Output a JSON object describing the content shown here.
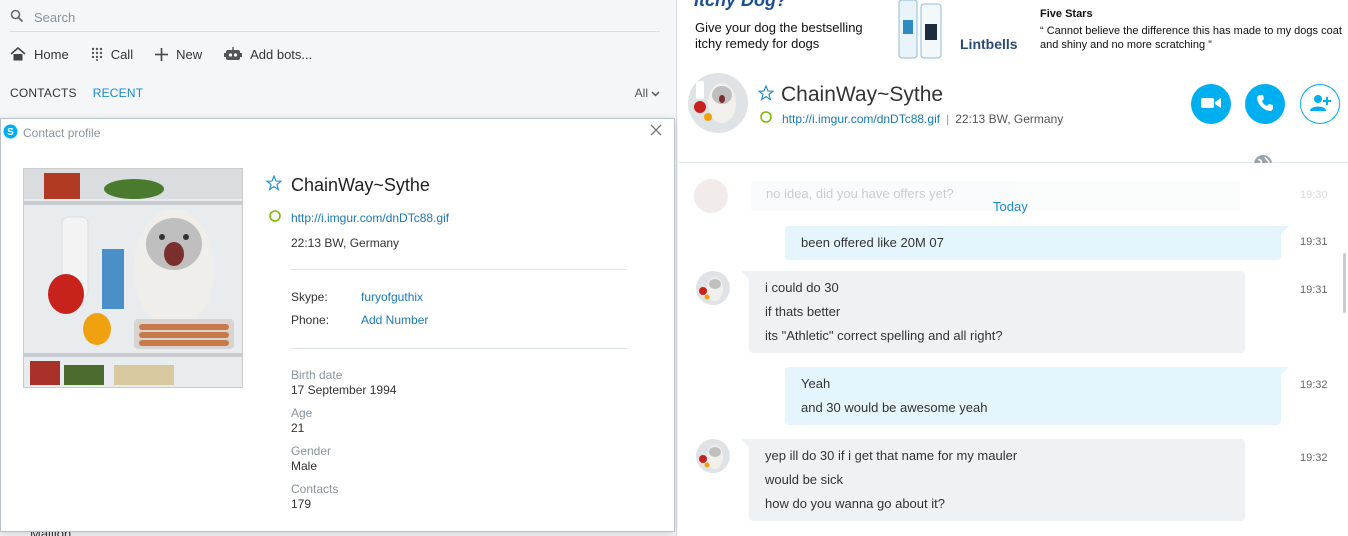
{
  "search": {
    "placeholder": "Search"
  },
  "toolbar": {
    "home": "Home",
    "call": "Call",
    "new": "New",
    "add_bots": "Add bots..."
  },
  "contacts_tabs": {
    "contacts": "CONTACTS",
    "recent": "RECENT",
    "filter": "All"
  },
  "left_list_partial": "Maillon",
  "profile": {
    "title": "Contact profile",
    "name": "ChainWay~Sythe",
    "mood_link": "http://i.imgur.com/dnDTc88.gif",
    "location": "22:13 BW, Germany",
    "skype_label": "Skype:",
    "skype_value": "furyofguthix",
    "phone_label": "Phone:",
    "phone_value": "Add Number",
    "birth_label": "Birth date",
    "birth_value": "17 September 1994",
    "age_label": "Age",
    "age_value": "21",
    "gender_label": "Gender",
    "gender_value": "Male",
    "contacts_label": "Contacts",
    "contacts_value": "179"
  },
  "ad": {
    "headline": "Itchy Dog?",
    "text": "Give your dog the bestselling itchy remedy for dogs",
    "brand": "Lintbells",
    "stars": "Five Stars",
    "quote": "Cannot believe the difference this has made to my dogs coat and shiny and no more scratching"
  },
  "chat_header": {
    "name": "ChainWay~Sythe",
    "link": "http://i.imgur.com/dnDTc88.gif",
    "separator": "|",
    "location": "22:13 BW, Germany"
  },
  "messages": {
    "faded": "no idea, did you have offers yet?",
    "faded_time": "19:30",
    "day_label": "Today",
    "list": [
      {
        "dir": "out",
        "lines": [
          "been offered like 20M 07"
        ],
        "time": "19:31"
      },
      {
        "dir": "in",
        "lines": [
          "i could do 30",
          "if thats better",
          "its \"Athletic\" correct spelling and all right?"
        ],
        "time": "19:31"
      },
      {
        "dir": "out",
        "lines": [
          "Yeah",
          "and 30 would be awesome yeah"
        ],
        "time": "19:32"
      },
      {
        "dir": "in",
        "lines": [
          "yep ill do 30 if i get that name for my mauler",
          "would be sick",
          "how do you wanna go about it?"
        ],
        "time": "19:32"
      }
    ]
  },
  "colors": {
    "accent": "#00aff0",
    "link": "#1a7ab5",
    "online": "#7ab800"
  }
}
